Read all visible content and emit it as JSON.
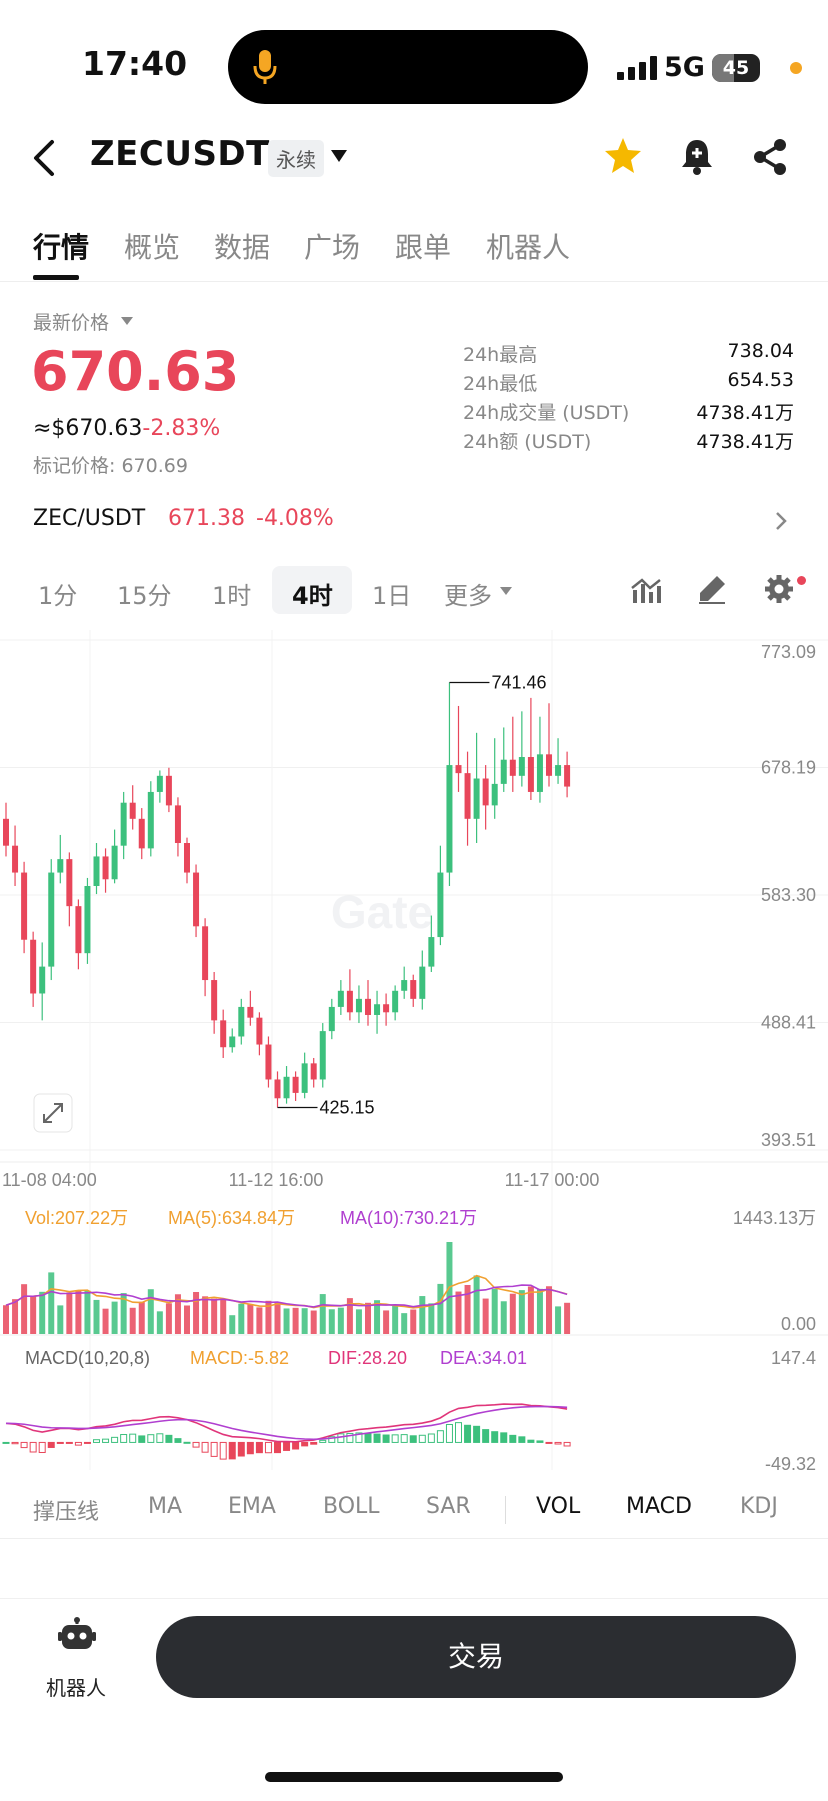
{
  "status_bar": {
    "time": "17:40",
    "network": "5G",
    "battery": "45",
    "battery_level": 0.45
  },
  "header": {
    "symbol": "ZECUSDT",
    "badge": "永续"
  },
  "tabs": [
    "行情",
    "概览",
    "数据",
    "广场",
    "跟单",
    "机器人"
  ],
  "price": {
    "label": "最新价格",
    "last": "670.63",
    "usd": "≈$670.63",
    "usd_change": "-2.83%",
    "mark": "标记价格: 670.69"
  },
  "stats": [
    {
      "label": "24h最高",
      "value": "738.04"
    },
    {
      "label": "24h最低",
      "value": "654.53"
    },
    {
      "label": "24h成交量 (USDT)",
      "value": "4738.41万"
    },
    {
      "label": "24h额 (USDT)",
      "value": "4738.41万"
    }
  ],
  "pair": {
    "name": "ZEC/USDT",
    "price": "671.38",
    "change": "-4.08%"
  },
  "timeframes": [
    "1分",
    "15分",
    "1时",
    "4时",
    "1日",
    "更多"
  ],
  "chart_data": {
    "type": "candlestick",
    "y_ticks": [
      "773.09",
      "678.19",
      "583.30",
      "488.41",
      "393.51"
    ],
    "ylim": [
      393.51,
      773.09
    ],
    "x_ticks": [
      "11-08 04:00",
      "11-12 16:00",
      "11-17 00:00"
    ],
    "annotations": {
      "high": "741.46",
      "low": "425.15"
    },
    "watermark": "Gate",
    "candles": [
      [
        640,
        620,
        652,
        612
      ],
      [
        620,
        600,
        635,
        590
      ],
      [
        600,
        550,
        608,
        540
      ],
      [
        550,
        510,
        556,
        500
      ],
      [
        510,
        530,
        548,
        490
      ],
      [
        530,
        600,
        610,
        520
      ],
      [
        600,
        610,
        628,
        592
      ],
      [
        610,
        575,
        615,
        560
      ],
      [
        575,
        540,
        580,
        528
      ],
      [
        540,
        590,
        596,
        532
      ],
      [
        590,
        612,
        622,
        584
      ],
      [
        612,
        595,
        618,
        585
      ],
      [
        595,
        620,
        632,
        592
      ],
      [
        620,
        652,
        660,
        610
      ],
      [
        652,
        640,
        665,
        632
      ],
      [
        640,
        618,
        648,
        610
      ],
      [
        618,
        660,
        668,
        612
      ],
      [
        660,
        672,
        676,
        652
      ],
      [
        672,
        650,
        678,
        645
      ],
      [
        650,
        622,
        656,
        612
      ],
      [
        622,
        600,
        626,
        592
      ],
      [
        600,
        560,
        606,
        552
      ],
      [
        560,
        520,
        566,
        508
      ],
      [
        520,
        490,
        526,
        480
      ],
      [
        490,
        470,
        498,
        462
      ],
      [
        470,
        478,
        484,
        466
      ],
      [
        478,
        500,
        506,
        472
      ],
      [
        500,
        492,
        512,
        486
      ],
      [
        492,
        472,
        496,
        464
      ],
      [
        472,
        446,
        478,
        440
      ],
      [
        446,
        432,
        452,
        425.15
      ],
      [
        432,
        448,
        456,
        428
      ],
      [
        448,
        436,
        452,
        430
      ],
      [
        436,
        458,
        466,
        432
      ],
      [
        458,
        446,
        462,
        440
      ],
      [
        446,
        482,
        488,
        440
      ],
      [
        482,
        500,
        506,
        476
      ],
      [
        500,
        512,
        520,
        494
      ],
      [
        512,
        496,
        528,
        490
      ],
      [
        496,
        506,
        516,
        488
      ],
      [
        506,
        494,
        520,
        486
      ],
      [
        494,
        502,
        512,
        480
      ],
      [
        502,
        496,
        510,
        486
      ],
      [
        496,
        512,
        516,
        490
      ],
      [
        512,
        520,
        530,
        506
      ],
      [
        520,
        506,
        524,
        500
      ],
      [
        506,
        530,
        542,
        498
      ],
      [
        530,
        552,
        568,
        526
      ],
      [
        552,
        600,
        620,
        546
      ],
      [
        600,
        680,
        741.46,
        590
      ],
      [
        680,
        674,
        724,
        660
      ],
      [
        674,
        640,
        690,
        620
      ],
      [
        640,
        670,
        704,
        622
      ],
      [
        670,
        650,
        680,
        632
      ],
      [
        650,
        666,
        700,
        640
      ],
      [
        666,
        684,
        708,
        660
      ],
      [
        684,
        672,
        716,
        660
      ],
      [
        672,
        686,
        720,
        664
      ],
      [
        686,
        660,
        730,
        654
      ],
      [
        660,
        688,
        716,
        652
      ],
      [
        688,
        672,
        726,
        664
      ],
      [
        672,
        680,
        700,
        666
      ],
      [
        680,
        664,
        690,
        656
      ]
    ],
    "volume": {
      "vol": "Vol:207.22万",
      "ma5": "MA(5):634.84万",
      "ma10": "MA(10):730.21万",
      "max": "1443.13万",
      "min": "0.00"
    },
    "macd": {
      "title": "MACD(10,20,8)",
      "macd": "MACD:-5.82",
      "dif": "DIF:28.20",
      "dea": "DEA:34.01",
      "max": "147.4",
      "min": "-49.32"
    }
  },
  "indicators": [
    "撑压线",
    "MA",
    "EMA",
    "BOLL",
    "SAR",
    "VOL",
    "MACD",
    "KDJ"
  ],
  "bottom": {
    "robot_label": "机器人",
    "trade_label": "交易"
  },
  "colors": {
    "up": "#3cc07d",
    "down": "#e8465a",
    "vol_ma5": "#f0a030",
    "vol_ma10": "#b03fd0",
    "dea": "#e0357a"
  }
}
